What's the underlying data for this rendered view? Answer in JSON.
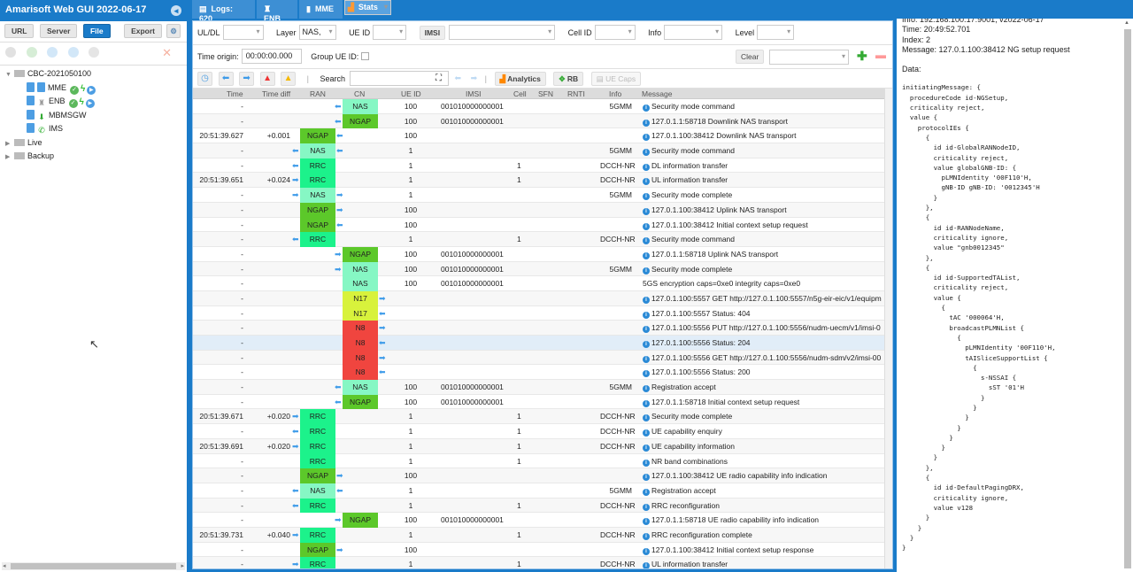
{
  "app": {
    "title": "Amarisoft Web GUI 2022-06-17"
  },
  "left": {
    "buttons": {
      "url": "URL",
      "server": "Server",
      "file": "File",
      "export": "Export"
    },
    "tree": [
      {
        "label": "CBC-2021050100",
        "type": "folder",
        "expanded": true
      },
      {
        "label": "MME",
        "type": "mme",
        "status": [
          "ok",
          "bolt",
          "play"
        ]
      },
      {
        "label": "ENB",
        "type": "enb",
        "status": [
          "ok",
          "bolt",
          "play"
        ]
      },
      {
        "label": "MBMSGW",
        "type": "mbmsgw"
      },
      {
        "label": "IMS",
        "type": "ims"
      },
      {
        "label": "Live",
        "type": "folder",
        "expanded": false
      },
      {
        "label": "Backup",
        "type": "folder",
        "expanded": false
      }
    ]
  },
  "tabs": [
    {
      "label": "Logs: 620",
      "icon": "document-icon"
    },
    {
      "label": "ENB",
      "icon": "antenna-icon"
    },
    {
      "label": "MME",
      "icon": "server-icon"
    },
    {
      "label": "Stats",
      "icon": "chart-icon"
    }
  ],
  "filters": {
    "uldl": {
      "label": "UL/DL",
      "value": ""
    },
    "layer": {
      "label": "Layer",
      "value": "NAS,"
    },
    "ueid": {
      "label": "UE ID",
      "value": ""
    },
    "imsi": {
      "label": "IMSI",
      "value": ""
    },
    "cellid": {
      "label": "Cell ID",
      "value": ""
    },
    "info": {
      "label": "Info",
      "value": ""
    },
    "level": {
      "label": "Level",
      "value": ""
    },
    "time_origin": {
      "label": "Time origin:",
      "value": "00:00:00.000"
    },
    "group_ueid": {
      "label": "Group UE ID:",
      "checked": false
    },
    "clear": "Clear",
    "preset": ""
  },
  "toolbar": {
    "search_label": "Search",
    "search_value": "",
    "analytics": "Analytics",
    "rb": "RB",
    "uecaps": "UE Caps"
  },
  "columns": [
    "Time",
    "Time diff",
    "RAN",
    "CN",
    "UE ID",
    "IMSI",
    "Cell",
    "SFN",
    "RNTI",
    "Info",
    "Message"
  ],
  "rows": [
    {
      "time": "-",
      "tdiff": "",
      "ran": "",
      "cn": "NAS",
      "dir": "cn-left",
      "ueid": "100",
      "imsi": "001010000000001",
      "cell": "",
      "info": "5GMM",
      "msg": "Security mode command",
      "i": true
    },
    {
      "time": "-",
      "tdiff": "",
      "ran": "",
      "cn": "NGAP",
      "dir": "cn-left",
      "ueid": "100",
      "imsi": "001010000000001",
      "cell": "",
      "info": "",
      "msg": "127.0.1.1:58718 Downlink NAS transport",
      "i": true
    },
    {
      "time": "20:51:39.627",
      "tdiff": "+0.001",
      "ran": "NGAP",
      "cn": "",
      "dir": "ran-right-in",
      "ueid": "100",
      "imsi": "",
      "cell": "",
      "info": "",
      "msg": "127.0.1.100:38412 Downlink NAS transport",
      "i": true
    },
    {
      "time": "-",
      "tdiff": "",
      "ran": "NAS",
      "cn": "",
      "dir": "both-left",
      "ueid": "1",
      "imsi": "",
      "cell": "",
      "info": "5GMM",
      "msg": "Security mode command",
      "i": true
    },
    {
      "time": "-",
      "tdiff": "",
      "ran": "RRC",
      "cn": "",
      "dir": "ran-left",
      "ueid": "1",
      "imsi": "",
      "cell": "1",
      "info": "DCCH-NR",
      "msg": "DL information transfer",
      "i": true
    },
    {
      "time": "20:51:39.651",
      "tdiff": "+0.024",
      "ran": "RRC",
      "cn": "",
      "dir": "ran-left-out",
      "ueid": "1",
      "imsi": "",
      "cell": "1",
      "info": "DCCH-NR",
      "msg": "UL information transfer",
      "i": true
    },
    {
      "time": "-",
      "tdiff": "",
      "ran": "NAS",
      "cn": "",
      "dir": "both-right",
      "ueid": "1",
      "imsi": "",
      "cell": "",
      "info": "5GMM",
      "msg": "Security mode complete",
      "i": true
    },
    {
      "time": "-",
      "tdiff": "",
      "ran": "NGAP",
      "cn": "",
      "dir": "ran-right-out",
      "ueid": "100",
      "imsi": "",
      "cell": "",
      "info": "",
      "msg": "127.0.1.100:38412 Uplink NAS transport",
      "i": true
    },
    {
      "time": "-",
      "tdiff": "",
      "ran": "NGAP",
      "cn": "",
      "dir": "ran-right-in",
      "ueid": "100",
      "imsi": "",
      "cell": "",
      "info": "",
      "msg": "127.0.1.100:38412 Initial context setup request",
      "i": true
    },
    {
      "time": "-",
      "tdiff": "",
      "ran": "RRC",
      "cn": "",
      "dir": "ran-left",
      "ueid": "1",
      "imsi": "",
      "cell": "1",
      "info": "DCCH-NR",
      "msg": "Security mode command",
      "i": true
    },
    {
      "time": "-",
      "tdiff": "",
      "ran": "",
      "cn": "NGAP",
      "dir": "cn-left-out",
      "ueid": "100",
      "imsi": "001010000000001",
      "cell": "",
      "info": "",
      "msg": "127.0.1.1:58718 Uplink NAS transport",
      "i": true
    },
    {
      "time": "-",
      "tdiff": "",
      "ran": "",
      "cn": "NAS",
      "dir": "cn-left-out",
      "ueid": "100",
      "imsi": "001010000000001",
      "cell": "",
      "info": "5GMM",
      "msg": "Security mode complete",
      "i": true
    },
    {
      "time": "-",
      "tdiff": "",
      "ran": "",
      "cn": "NAS",
      "dir": "",
      "ueid": "100",
      "imsi": "001010000000001",
      "cell": "",
      "info": "",
      "msg": "5GS encryption caps=0xe0 integrity caps=0xe0",
      "i": false
    },
    {
      "time": "-",
      "tdiff": "",
      "ran": "",
      "cn": "N17",
      "dir": "cn-right-out",
      "ueid": "",
      "imsi": "",
      "cell": "",
      "info": "",
      "msg": "127.0.1.100:5557 GET http://127.0.1.100:5557/n5g-eir-eic/v1/equipm",
      "i": true
    },
    {
      "time": "-",
      "tdiff": "",
      "ran": "",
      "cn": "N17",
      "dir": "cn-right-in",
      "ueid": "",
      "imsi": "",
      "cell": "",
      "info": "",
      "msg": "127.0.1.100:5557 Status: 404",
      "i": true
    },
    {
      "time": "-",
      "tdiff": "",
      "ran": "",
      "cn": "N8",
      "dir": "cn-right-out",
      "ueid": "",
      "imsi": "",
      "cell": "",
      "info": "",
      "msg": "127.0.1.100:5556 PUT http://127.0.1.100:5556/nudm-uecm/v1/imsi-0",
      "i": true
    },
    {
      "time": "-",
      "tdiff": "",
      "ran": "",
      "cn": "N8",
      "dir": "cn-right-in",
      "ueid": "",
      "imsi": "",
      "cell": "",
      "info": "",
      "msg": "127.0.1.100:5556 Status: 204",
      "i": true,
      "hl": true
    },
    {
      "time": "-",
      "tdiff": "",
      "ran": "",
      "cn": "N8",
      "dir": "cn-right-out",
      "ueid": "",
      "imsi": "",
      "cell": "",
      "info": "",
      "msg": "127.0.1.100:5556 GET http://127.0.1.100:5556/nudm-sdm/v2/imsi-00",
      "i": true
    },
    {
      "time": "-",
      "tdiff": "",
      "ran": "",
      "cn": "N8",
      "dir": "cn-right-in",
      "ueid": "",
      "imsi": "",
      "cell": "",
      "info": "",
      "msg": "127.0.1.100:5556 Status: 200",
      "i": true
    },
    {
      "time": "-",
      "tdiff": "",
      "ran": "",
      "cn": "NAS",
      "dir": "cn-left",
      "ueid": "100",
      "imsi": "001010000000001",
      "cell": "",
      "info": "5GMM",
      "msg": "Registration accept",
      "i": true
    },
    {
      "time": "-",
      "tdiff": "",
      "ran": "",
      "cn": "NGAP",
      "dir": "cn-left",
      "ueid": "100",
      "imsi": "001010000000001",
      "cell": "",
      "info": "",
      "msg": "127.0.1.1:58718 Initial context setup request",
      "i": true
    },
    {
      "time": "20:51:39.671",
      "tdiff": "+0.020",
      "ran": "RRC",
      "cn": "",
      "dir": "ran-left-out",
      "ueid": "1",
      "imsi": "",
      "cell": "1",
      "info": "DCCH-NR",
      "msg": "Security mode complete",
      "i": true
    },
    {
      "time": "-",
      "tdiff": "",
      "ran": "RRC",
      "cn": "",
      "dir": "ran-left",
      "ueid": "1",
      "imsi": "",
      "cell": "1",
      "info": "DCCH-NR",
      "msg": "UE capability enquiry",
      "i": true
    },
    {
      "time": "20:51:39.691",
      "tdiff": "+0.020",
      "ran": "RRC",
      "cn": "",
      "dir": "ran-left-out",
      "ueid": "1",
      "imsi": "",
      "cell": "1",
      "info": "DCCH-NR",
      "msg": "UE capability information",
      "i": true
    },
    {
      "time": "-",
      "tdiff": "",
      "ran": "RRC",
      "cn": "",
      "dir": "",
      "ueid": "1",
      "imsi": "",
      "cell": "1",
      "info": "",
      "msg": "NR band combinations",
      "i": true
    },
    {
      "time": "-",
      "tdiff": "",
      "ran": "NGAP",
      "cn": "",
      "dir": "ran-right-out",
      "ueid": "100",
      "imsi": "",
      "cell": "",
      "info": "",
      "msg": "127.0.1.100:38412 UE radio capability info indication",
      "i": true
    },
    {
      "time": "-",
      "tdiff": "",
      "ran": "NAS",
      "cn": "",
      "dir": "both-left",
      "ueid": "1",
      "imsi": "",
      "cell": "",
      "info": "5GMM",
      "msg": "Registration accept",
      "i": true
    },
    {
      "time": "-",
      "tdiff": "",
      "ran": "RRC",
      "cn": "",
      "dir": "ran-left",
      "ueid": "1",
      "imsi": "",
      "cell": "1",
      "info": "DCCH-NR",
      "msg": "RRC reconfiguration",
      "i": true
    },
    {
      "time": "-",
      "tdiff": "",
      "ran": "",
      "cn": "NGAP",
      "dir": "cn-left-out",
      "ueid": "100",
      "imsi": "001010000000001",
      "cell": "",
      "info": "",
      "msg": "127.0.1.1:58718 UE radio capability info indication",
      "i": true
    },
    {
      "time": "20:51:39.731",
      "tdiff": "+0.040",
      "ran": "RRC",
      "cn": "",
      "dir": "ran-left-out",
      "ueid": "1",
      "imsi": "",
      "cell": "1",
      "info": "DCCH-NR",
      "msg": "RRC reconfiguration complete",
      "i": true
    },
    {
      "time": "-",
      "tdiff": "",
      "ran": "NGAP",
      "cn": "",
      "dir": "ran-right-out",
      "ueid": "100",
      "imsi": "",
      "cell": "",
      "info": "",
      "msg": "127.0.1.100:38412 Initial context setup response",
      "i": true
    },
    {
      "time": "-",
      "tdiff": "",
      "ran": "RRC",
      "cn": "",
      "dir": "ran-left-out",
      "ueid": "1",
      "imsi": "",
      "cell": "1",
      "info": "DCCH-NR",
      "msg": "UL information transfer",
      "i": true
    }
  ],
  "detail": {
    "info": "Info: 192.168.100.17:9001, v2022-06-17",
    "time": "Time: 20:49:52.701",
    "index": "Index: 2",
    "message": "Message: 127.0.1.100:38412 NG setup request",
    "data_label": "Data:",
    "data": "initiatingMessage: {\n  procedureCode id-NGSetup,\n  criticality reject,\n  value {\n    protocolIEs {\n      {\n        id id-GlobalRANNodeID,\n        criticality reject,\n        value globalGNB-ID: {\n          pLMNIdentity '00F110'H,\n          gNB-ID gNB-ID: '0012345'H\n        }\n      },\n      {\n        id id-RANNodeName,\n        criticality ignore,\n        value \"gnb0012345\"\n      },\n      {\n        id id-SupportedTAList,\n        criticality reject,\n        value {\n          {\n            tAC '000064'H,\n            broadcastPLMNList {\n              {\n                pLMNIdentity '00F110'H,\n                tAISliceSupportList {\n                  {\n                    s-NSSAI {\n                      sST '01'H\n                    }\n                  }\n                }\n              }\n            }\n          }\n        }\n      },\n      {\n        id id-DefaultPagingDRX,\n        criticality ignore,\n        value v128\n      }\n    }\n  }\n}"
  },
  "colors": {
    "accent": "#1a7bc9",
    "NAS": "#86f7c4",
    "NGAP": "#5cc82a",
    "RRC": "#1cf28b",
    "N17": "#d8f23c",
    "N8": "#f0453f"
  }
}
